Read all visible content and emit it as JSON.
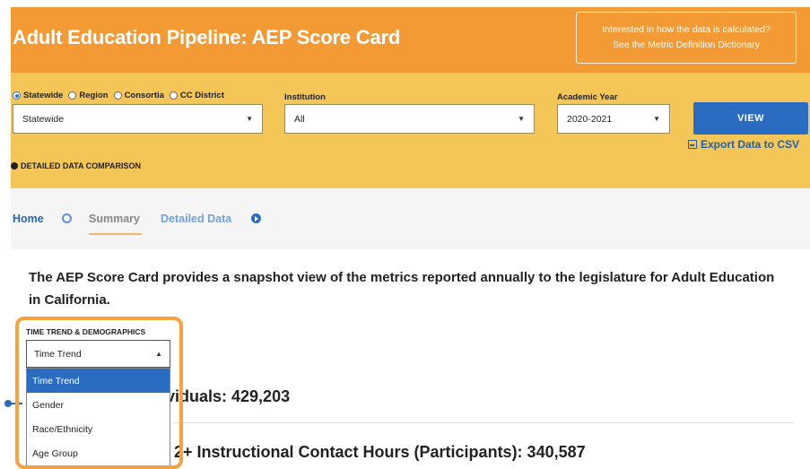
{
  "header": {
    "title": "Adult Education Pipeline: AEP Score Card",
    "cta_line1": "Interested in how the data is calculated?",
    "cta_line2": "See the Metric Definition Dictionary"
  },
  "filters": {
    "scope_options": [
      "Statewide",
      "Region",
      "Consortia",
      "CC District"
    ],
    "scope_selected": "Statewide",
    "scope_value": "Statewide",
    "institution_label": "Institution",
    "institution_value": "All",
    "year_label": "Academic Year",
    "year_value": "2020-2021",
    "view_label": "VIEW",
    "export_label": "Export Data to CSV",
    "detailed_compare_label": "DETAILED DATA COMPARISON"
  },
  "nav": {
    "home": "Home",
    "summary": "Summary",
    "detailed": "Detailed Data"
  },
  "intro": "The AEP Score Card provides a snapshot view of the metrics reported annually to the legislature for Adult Education in California.",
  "dropdown": {
    "label": "TIME TREND & DEMOGRAPHICS",
    "value": "Time Trend",
    "options": [
      "Time Trend",
      "Gender",
      "Race/Ethnicity",
      "Age Group"
    ]
  },
  "stats": {
    "line1": "viduals: 429,203",
    "line2": "2+ Instructional Contact Hours (Participants): 340,587"
  },
  "colors": {
    "header_bg": "#f49a35",
    "filters_bg": "#f4c657",
    "accent_blue": "#2a6cc1",
    "highlight_orange": "#f7a23e"
  }
}
